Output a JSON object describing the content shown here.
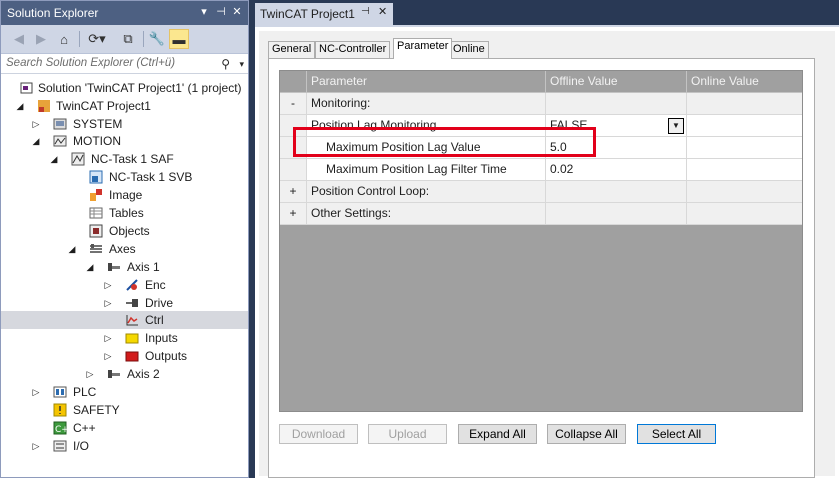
{
  "solution_explorer": {
    "title": "Solution Explorer",
    "title_controls": {
      "dropdown": "▾",
      "pin": "⊣",
      "close": "✕"
    },
    "search_placeholder": "Search Solution Explorer (Ctrl+ü)",
    "tree": [
      {
        "label": "Solution 'TwinCAT Project1' (1 project)",
        "icon": "solution-icon"
      },
      {
        "label": "TwinCAT Project1",
        "icon": "twincat-project-icon"
      },
      {
        "label": "SYSTEM",
        "icon": "system-icon"
      },
      {
        "label": "MOTION",
        "icon": "motion-icon"
      },
      {
        "label": "NC-Task 1 SAF",
        "icon": "nc-task-icon"
      },
      {
        "label": "NC-Task 1 SVB",
        "icon": "nc-svb-icon"
      },
      {
        "label": "Image",
        "icon": "image-icon"
      },
      {
        "label": "Tables",
        "icon": "tables-icon"
      },
      {
        "label": "Objects",
        "icon": "objects-icon"
      },
      {
        "label": "Axes",
        "icon": "axes-icon"
      },
      {
        "label": "Axis 1",
        "icon": "axis-icon"
      },
      {
        "label": "Enc",
        "icon": "encoder-icon"
      },
      {
        "label": "Drive",
        "icon": "drive-icon"
      },
      {
        "label": "Ctrl",
        "icon": "controller-icon"
      },
      {
        "label": "Inputs",
        "icon": "inputs-icon"
      },
      {
        "label": "Outputs",
        "icon": "outputs-icon"
      },
      {
        "label": "Axis 2",
        "icon": "axis-icon"
      },
      {
        "label": "PLC",
        "icon": "plc-icon"
      },
      {
        "label": "SAFETY",
        "icon": "safety-icon"
      },
      {
        "label": "C++",
        "icon": "cpp-icon"
      },
      {
        "label": "I/O",
        "icon": "io-icon"
      }
    ]
  },
  "document": {
    "tab_title": "TwinCAT Project1",
    "tab_pin": "⊣",
    "tab_close": "✕",
    "tabs": [
      {
        "label": "General"
      },
      {
        "label": "NC-Controller"
      },
      {
        "label": "Parameter"
      },
      {
        "label": "Online"
      }
    ],
    "grid": {
      "headers": {
        "parameter": "Parameter",
        "offline": "Offline Value",
        "online": "Online Value"
      },
      "rows": [
        {
          "gutter": "-",
          "name": "Monitoring:",
          "offline": "",
          "online": ""
        },
        {
          "gutter": "",
          "name": "Position Lag Monitoring",
          "offline": "FALSE",
          "online": ""
        },
        {
          "gutter": "",
          "name": "Maximum Position Lag Value",
          "offline": "5.0",
          "online": ""
        },
        {
          "gutter": "",
          "name": "Maximum Position Lag Filter Time",
          "offline": "0.02",
          "online": ""
        },
        {
          "gutter": "+",
          "name": "Position Control Loop:",
          "offline": "",
          "online": ""
        },
        {
          "gutter": "+",
          "name": "Other Settings:",
          "offline": "",
          "online": ""
        }
      ]
    },
    "buttons": {
      "download": "Download",
      "upload": "Upload",
      "expand_all": "Expand All",
      "collapse_all": "Collapse All",
      "select_all": "Select All"
    }
  },
  "colors": {
    "highlight": "#e2001a",
    "title_bar": "#4d6082",
    "background": "#293955"
  }
}
